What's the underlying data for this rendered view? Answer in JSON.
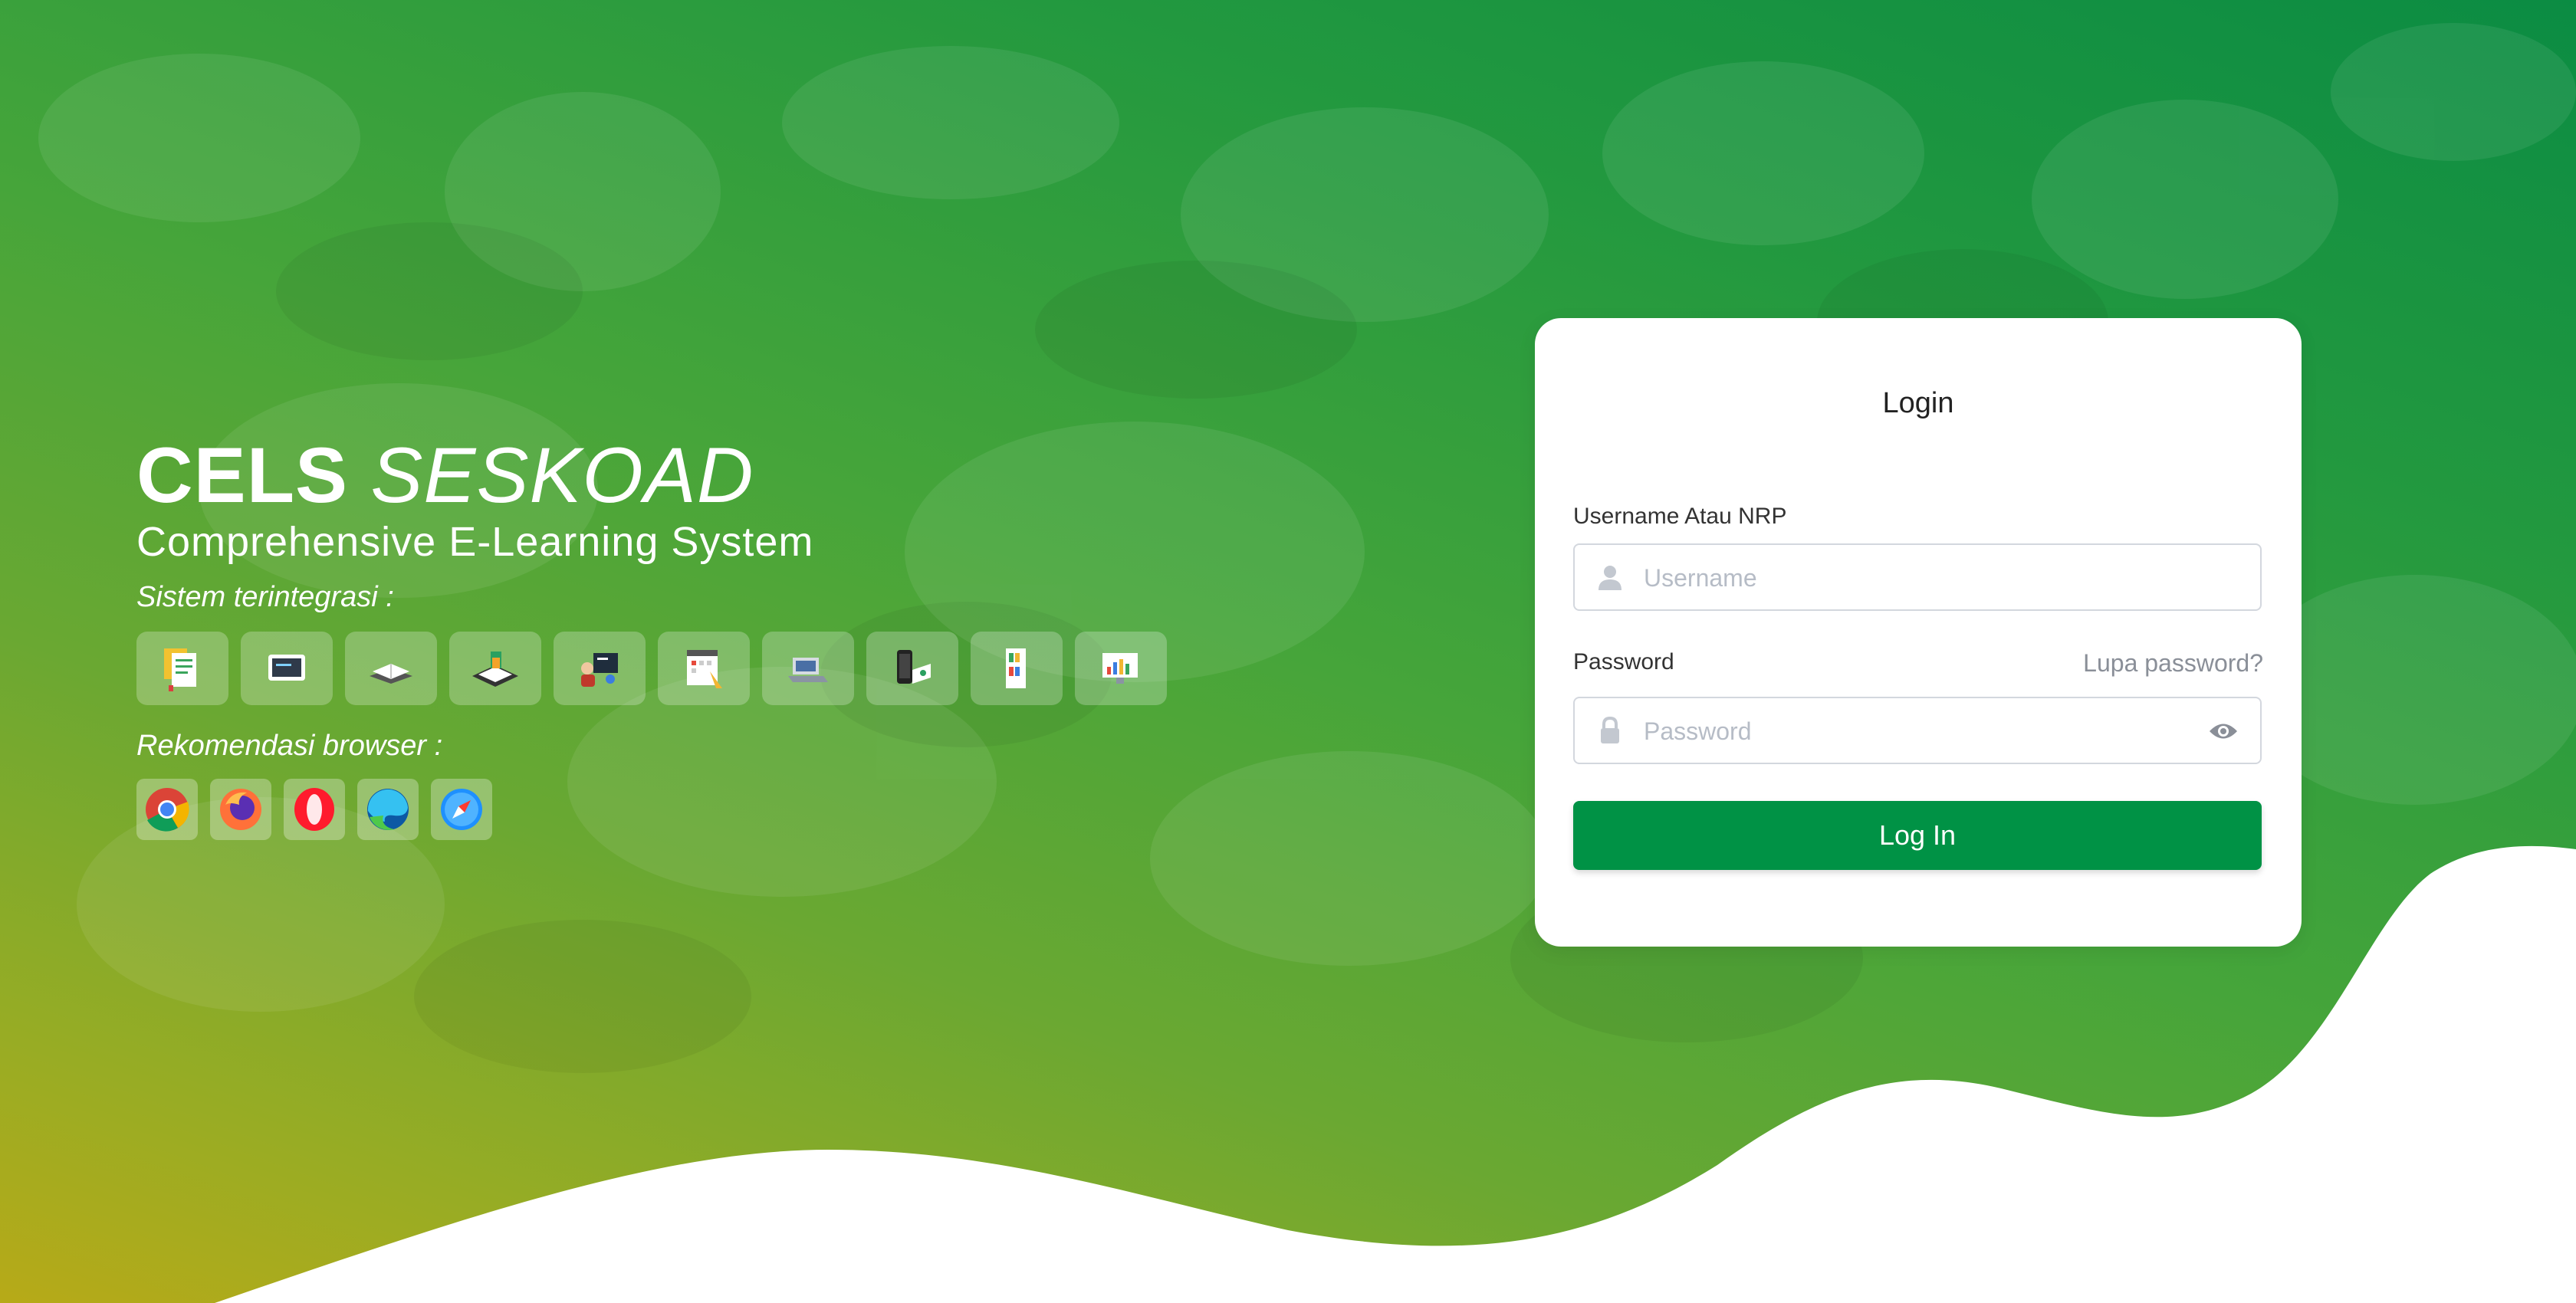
{
  "brand": {
    "title_bold": "CELS",
    "title_italic": "SESKOAD",
    "subtitle": "Comprehensive E-Learning System",
    "systems_label": "Sistem terintegrasi :",
    "browsers_label": "Rekomendasi browser :"
  },
  "integrated_systems": [
    {
      "icon": "document-stack-icon"
    },
    {
      "icon": "tablet-icon"
    },
    {
      "icon": "open-book-icon"
    },
    {
      "icon": "classroom-icon"
    },
    {
      "icon": "presentation-icon"
    },
    {
      "icon": "calendar-planner-icon"
    },
    {
      "icon": "laptop-icon"
    },
    {
      "icon": "mobile-device-icon"
    },
    {
      "icon": "bookshelf-icon"
    },
    {
      "icon": "monitor-chart-icon"
    }
  ],
  "browsers": [
    {
      "icon": "chrome-icon"
    },
    {
      "icon": "firefox-icon"
    },
    {
      "icon": "opera-icon"
    },
    {
      "icon": "edge-icon"
    },
    {
      "icon": "safari-icon"
    }
  ],
  "login": {
    "title": "Login",
    "username_label": "Username Atau NRP",
    "username_placeholder": "Username",
    "username_value": "",
    "password_label": "Password",
    "forgot_label": "Lupa password?",
    "password_placeholder": "Password",
    "password_value": "",
    "submit_label": "Log In"
  },
  "colors": {
    "primary_button": "#009245",
    "bg_top": "#0b8c43",
    "bg_bottom": "#b7aa18",
    "card": "#ffffff"
  }
}
